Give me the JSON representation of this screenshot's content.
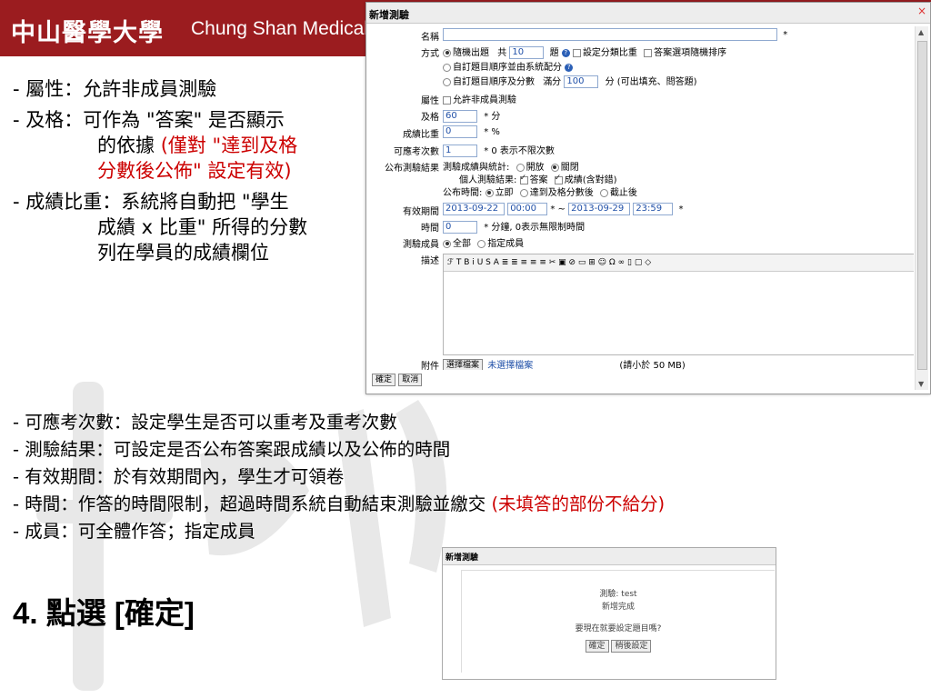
{
  "header": {
    "logo_cn": "中山醫學大學",
    "logo_en": "Chung Shan Medical"
  },
  "bullets_left": {
    "b1": "- 屬性：允許非成員測驗",
    "b2_head": "- 及格：可作為 \"答案\" 是否顯示",
    "b2_cont1": "的依據",
    "b2_red1": "(僅對 \"達到及格",
    "b2_red2": "分數後公佈\" 設定有效)",
    "b3_head": "- 成績比重：系統將自動把 \"學生",
    "b3_cont1": "成績 x 比重\" 所得的分數",
    "b3_cont2": "列在學員的成績欄位"
  },
  "bullets_bottom": {
    "b1": "- 可應考次數：設定學生是否可以重考及重考次數",
    "b2": "- 測驗結果：可設定是否公布答案跟成績以及公佈的時間",
    "b3": "- 有效期間：於有效期間內，學生才可領卷",
    "b4_black": "- 時間：作答的時間限制，超過時間系統自動結束測驗並繳交",
    "b4_red": "(未填答的部份不給分)",
    "b5": "- 成員：可全體作答；指定成員"
  },
  "step": "4. 點選 [確定]",
  "dialog": {
    "title": "新增測驗",
    "close": "×",
    "name_label": "名稱",
    "name_value": "",
    "name_required": "*",
    "method_label": "方式",
    "method_opt1": "隨機出題",
    "method_opt1_total": "共",
    "method_opt1_count": "10",
    "method_opt1_unit": "題",
    "method_chk1": "設定分類比重",
    "method_chk2": "答案選項隨機排序",
    "method_opt2": "自訂題目順序並由系統配分",
    "method_opt3": "自訂題目順序及分數",
    "method_opt3_full": "滿分",
    "method_opt3_score": "100",
    "method_opt3_unit": "分 (可出填充、問答題)",
    "attr_label": "屬性",
    "attr_chk": "允許非成員測驗",
    "pass_label": "及格",
    "pass_value": "60",
    "pass_unit": "* 分",
    "weight_label": "成績比重",
    "weight_value": "0",
    "weight_unit": "* %",
    "attempts_label": "可應考次數",
    "attempts_value": "1",
    "attempts_note": "* 0 表示不限次數",
    "result_label": "公布測驗結果",
    "result_line1": "測驗成績與統計:",
    "result_open": "開放",
    "result_close": "關閉",
    "result_line2": "個人測驗結果:",
    "result_answer": "答案",
    "result_score": "成績(含對錯)",
    "result_line3": "公布時間:",
    "result_now": "立即",
    "result_after_pass": "達到及格分數後",
    "result_after_end": "截止後",
    "period_label": "有效期間",
    "period_start_date": "2013-09-22",
    "period_start_time": "00:00",
    "period_sep": "* ~",
    "period_end_date": "2013-09-29",
    "period_end_time": "23:59",
    "period_required": "*",
    "time_label": "時間",
    "time_value": "0",
    "time_note": "* 分鐘, 0表示無限制時間",
    "member_label": "測驗成員",
    "member_all": "全部",
    "member_select": "指定成員",
    "desc_label": "描述",
    "toolbar": "ℱ  T  B  i  U  S  A  ≣  ≣  ≡  ≡  ≡  ✂  ▣  ⊘  ▭  ⊞  ☺  Ω  ∞  ▯  ▢  ◇",
    "attach_label": "附件",
    "attach_button": "選擇檔案",
    "attach_none": "未選擇檔案",
    "attach_note": "(請小於 50 MB)",
    "ok_button": "確定",
    "cancel_button": "取消"
  },
  "dialog2": {
    "title": "新增測驗",
    "line1": "測驗: test",
    "line2": "新增完成",
    "question": "要現在就要設定題目嗎?",
    "ok_button": "確定",
    "later_button": "稍後設定"
  },
  "colors": {
    "header": "#9b1c1f",
    "red_text": "#cc0000"
  }
}
